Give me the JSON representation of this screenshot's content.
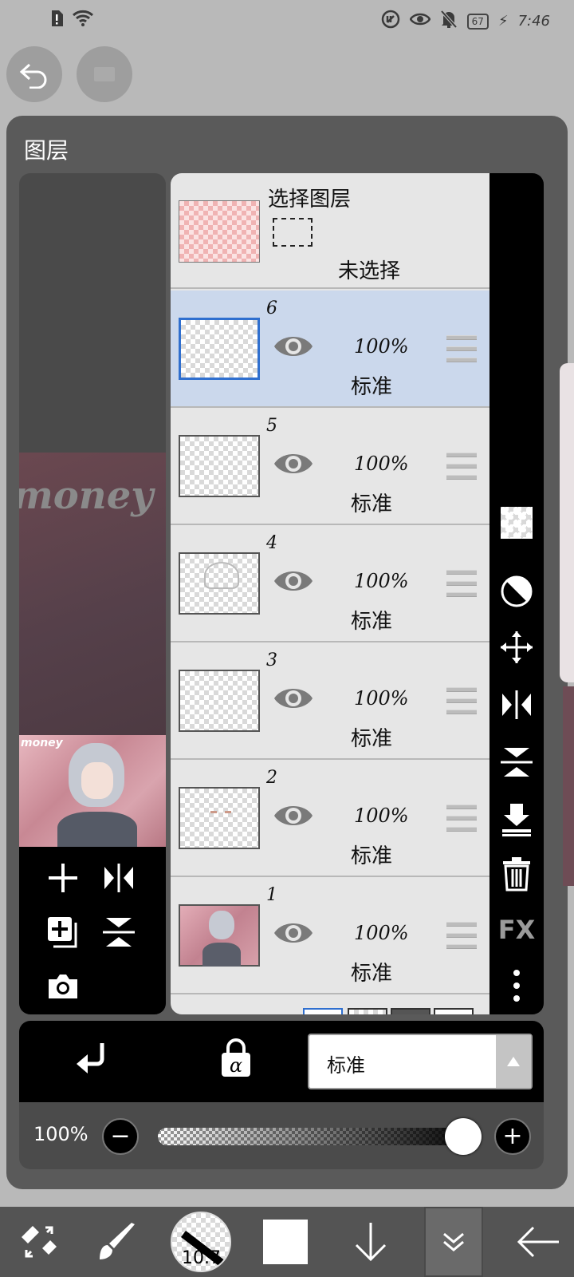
{
  "status_bar": {
    "battery": "67",
    "time": "7:46"
  },
  "panel": {
    "title": "图层"
  },
  "preview": {
    "watermark": "money"
  },
  "selection_layer": {
    "title": "选择图层",
    "status": "未选择"
  },
  "layers": [
    {
      "number": "6",
      "opacity": "100%",
      "blend": "标准",
      "selected": true
    },
    {
      "number": "5",
      "opacity": "100%",
      "blend": "标准",
      "selected": false
    },
    {
      "number": "4",
      "opacity": "100%",
      "blend": "标准",
      "selected": false
    },
    {
      "number": "3",
      "opacity": "100%",
      "blend": "标准",
      "selected": false
    },
    {
      "number": "2",
      "opacity": "100%",
      "blend": "标准",
      "selected": false
    },
    {
      "number": "1",
      "opacity": "100%",
      "blend": "标准",
      "selected": false
    }
  ],
  "right_toolbar": {
    "fx_label": "FX",
    "icons": [
      "checker-icon",
      "half-circle-icon",
      "move-icon",
      "flip-horizontal-icon",
      "flip-vertical-icon",
      "merge-down-icon",
      "trash-icon",
      "fx-icon",
      "more-vert-icon"
    ]
  },
  "blend_mode": {
    "value": "标准"
  },
  "opacity": {
    "label": "100%",
    "value": 1.0
  },
  "bottom_toolbar": {
    "brush_size": "10.7",
    "color": "#ffffff"
  },
  "colors": {
    "selected_row": "#cbd8ec",
    "selected_border": "#2f6fcf",
    "panel_bg": "#5a5a5a",
    "toolbar_bg": "#000000"
  }
}
